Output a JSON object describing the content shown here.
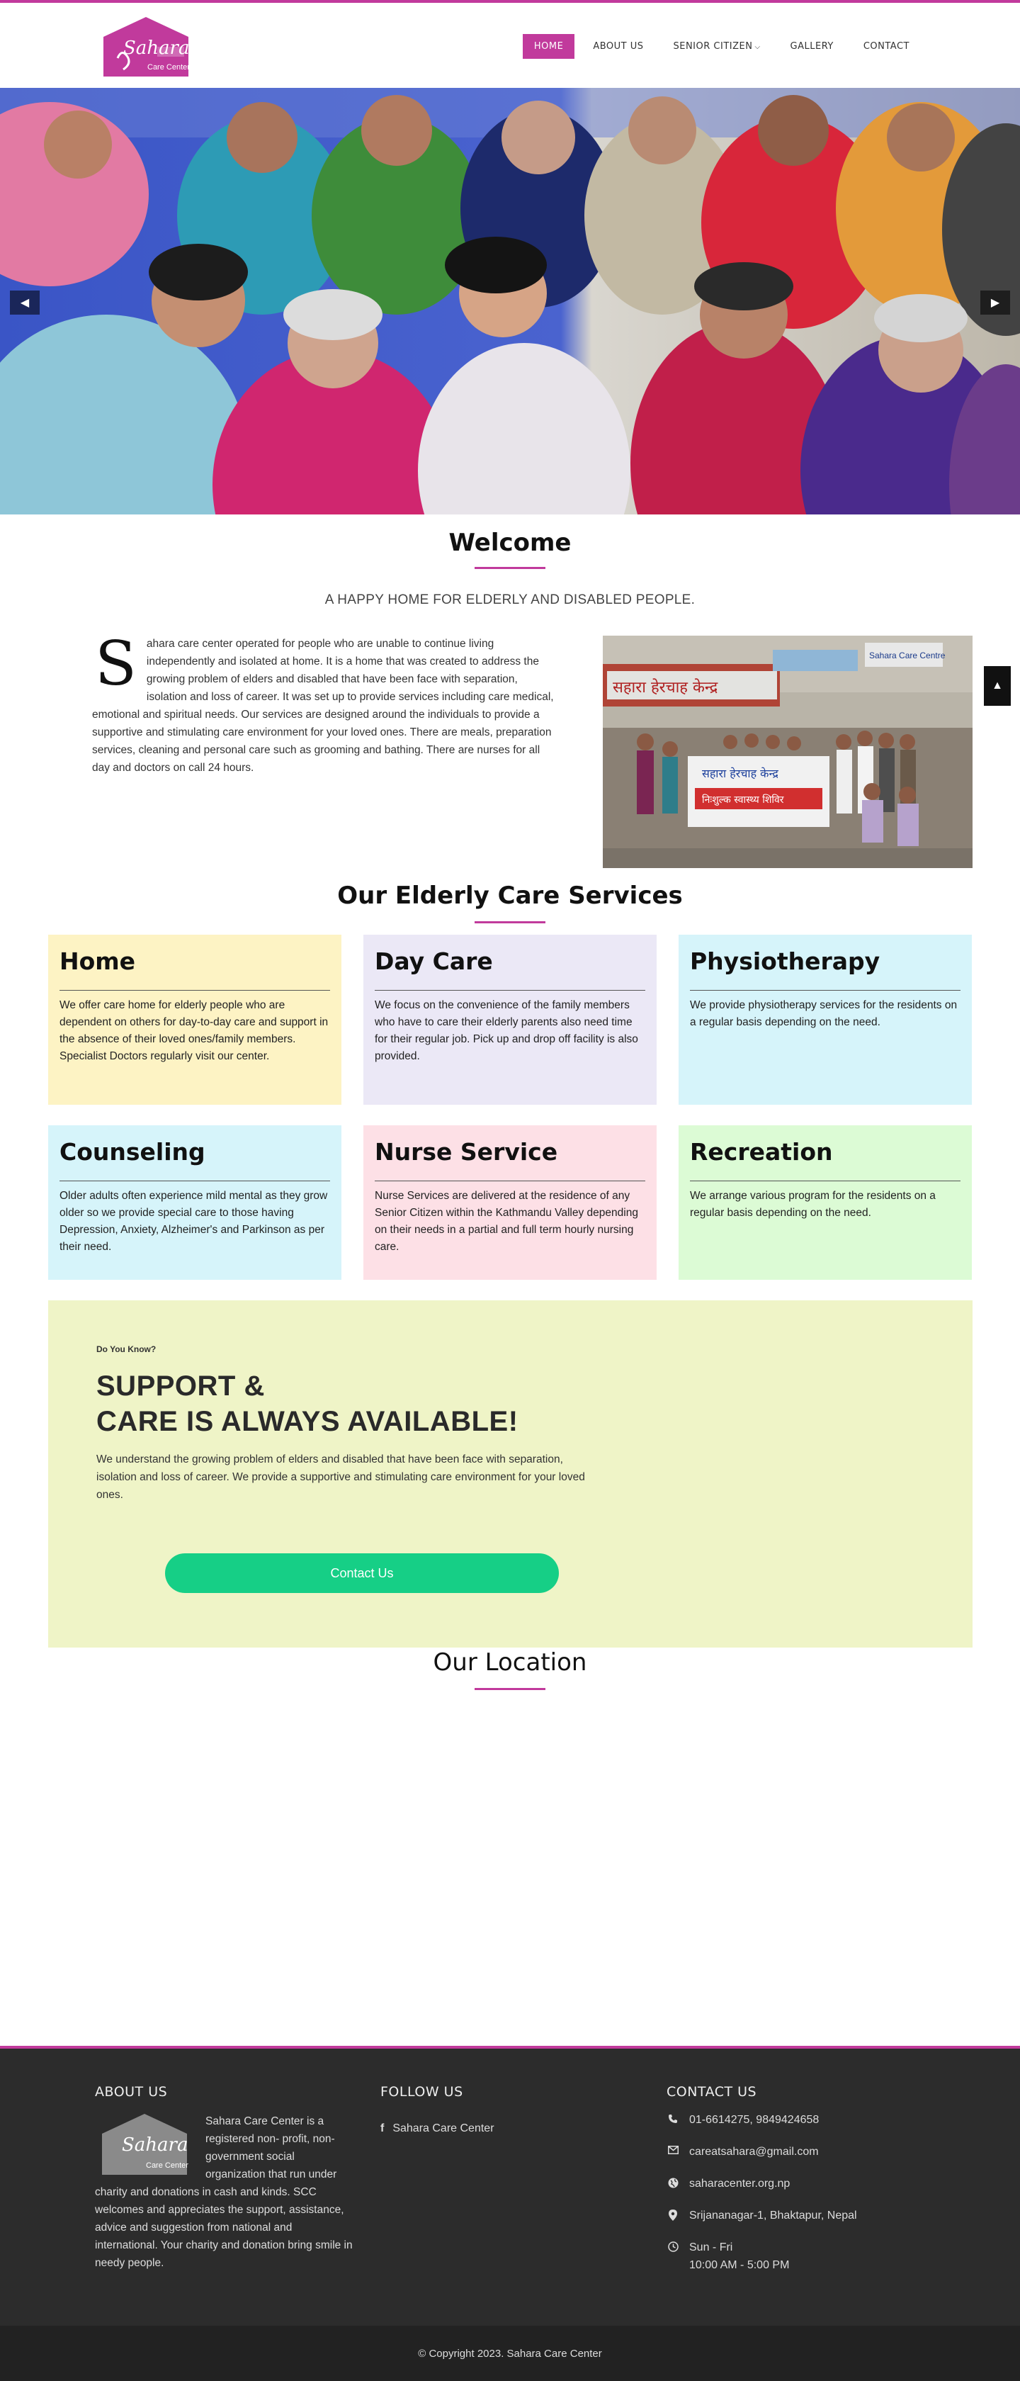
{
  "brand": {
    "logo_word": "Sahara",
    "logo_sub": "Care Center",
    "accent": "#c13a9c",
    "button_green": "#16cf86"
  },
  "nav": {
    "items": [
      {
        "label": "HOME"
      },
      {
        "label": "ABOUT US"
      },
      {
        "label": "SENIOR CITIZEN"
      },
      {
        "label": "GALLERY"
      },
      {
        "label": "CONTACT"
      }
    ]
  },
  "welcome": {
    "title": "Welcome",
    "tagline": "A HAPPY HOME FOR ELDERLY AND DISABLED PEOPLE.",
    "dropcap": "S",
    "text": "ahara care center operated for people who are unable to continue living independently and isolated at home. It is a home that was created to address the growing problem of elders and disabled that have been face with separation, isolation and loss of career. It was set up to provide services including care medical, emotional and spiritual needs. Our services are designed around the individuals to provide a supportive and stimulating care environment for your loved ones. There are meals, preparation services, cleaning and personal care such as grooming and bathing. There are nurses for all day and doctors on call 24 hours.",
    "banner_text_1": "सहारा हेरचाह केन्द्र",
    "banner_text_2": "सहारा हेरचाह केन्द्र",
    "banner_text_3": "निःशुल्क स्वास्थ्य शिविर",
    "sign_text": "Sahara Care Centre"
  },
  "services": {
    "title": "Our Elderly Care Services",
    "cards": [
      {
        "title": "Home",
        "text": "We offer care home for elderly people who are dependent on others for day-to-day care and support in the absence of their loved ones/family members. Specialist Doctors regularly visit our center.",
        "bg": "#fdf3c4"
      },
      {
        "title": "Day Care",
        "text": "We focus on the convenience of the family members who have to care their elderly parents also need time for their regular job. Pick up and drop off facility is also provided.",
        "bg": "#ebe8f6"
      },
      {
        "title": "Physiotherapy",
        "text": "We provide physiotherapy services for the residents on a regular basis depending on the need.",
        "bg": "#d6f4fa"
      },
      {
        "title": "Counseling",
        "text": "Older adults often experience mild mental as they grow older so we provide special care to those having Depression, Anxiety, Alzheimer's and Parkinson as per their need.",
        "bg": "#d6f4fa"
      },
      {
        "title": "Nurse Service",
        "text": "Nurse Services are delivered at the residence of any Senior Citizen within the Kathmandu Valley depending on their needs in a partial and full term hourly nursing care.",
        "bg": "#fde0e6"
      },
      {
        "title": "Recreation",
        "text": "We arrange various program for the residents on a regular basis depending on the need.",
        "bg": "#dcfbd5"
      }
    ]
  },
  "support": {
    "kicker": "Do You Know?",
    "heading_1": "SUPPORT &",
    "heading_2": "CARE IS ALWAYS AVAILABLE!",
    "text": "We understand the growing problem of elders and disabled that have been face with separation, isolation and loss of career. We provide a supportive and stimulating care environment for your loved ones.",
    "button": "Contact Us"
  },
  "location": {
    "title": "Our Location"
  },
  "footer": {
    "about_title": "ABOUT US",
    "about_text": "Sahara Care Center is a registered non- profit, non-government social organization that run under charity and donations in cash and kinds. SCC welcomes and appreciates the support, assistance, advice and suggestion from national and international. Your charity and donation bring smile in needy people.",
    "follow_title": "FOLLOW US",
    "follow_link": "Sahara Care Center",
    "contact_title": "CONTACT US",
    "phone": "01-6614275, 9849424658",
    "email": "careatsahara@gmail.com",
    "website": "saharacenter.org.np",
    "address": "Srijananagar-1, Bhaktapur, Nepal",
    "hours_days": "Sun - Fri",
    "hours_time": "10:00 AM - 5:00 PM",
    "copyright": "© Copyright 2023. Sahara Care Center"
  }
}
